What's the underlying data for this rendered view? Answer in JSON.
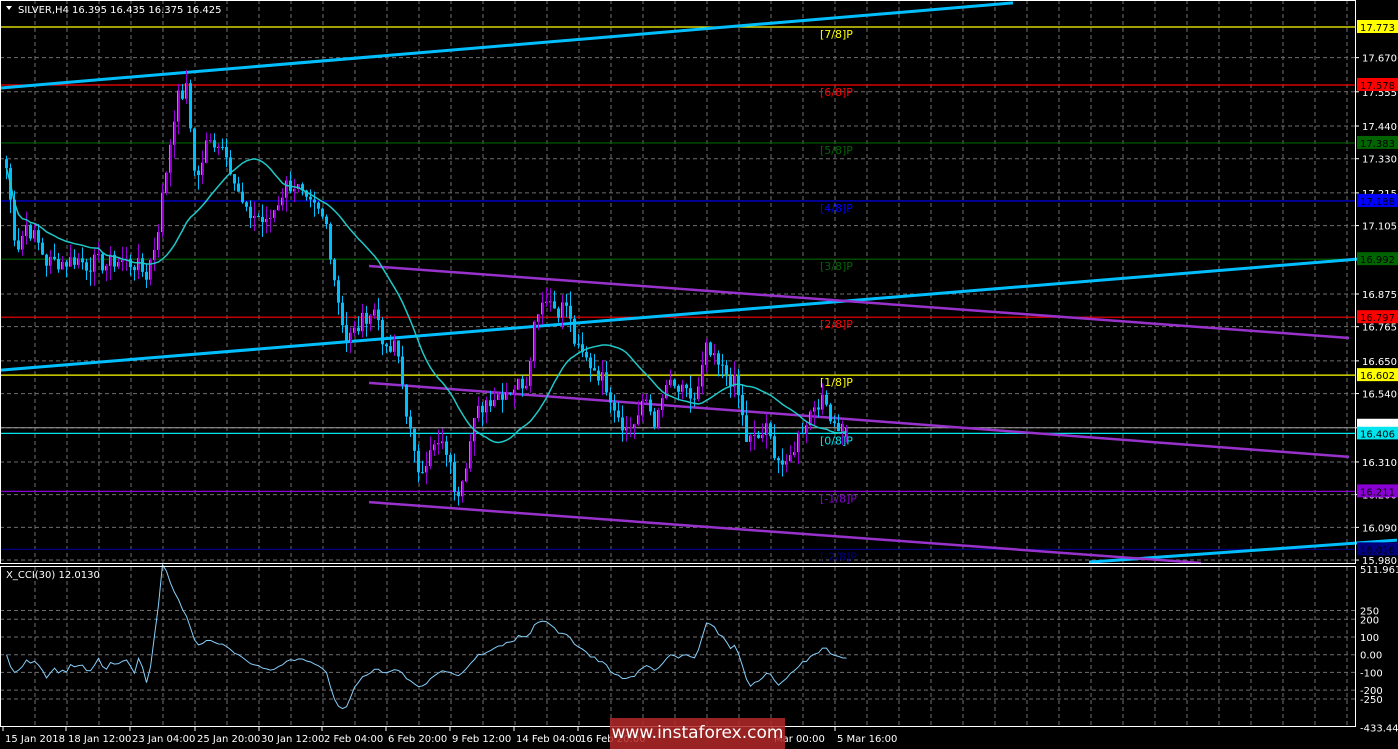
{
  "header": {
    "symbol": "SILVER,H4",
    "ohlc": "16.395 16.435 16.375 16.425"
  },
  "watermark": "www.instaforex.com",
  "chart_data": [
    {
      "type": "candlestick",
      "title": "SILVER,H4",
      "timeframe": "H4",
      "last_bar": {
        "open": 16.395,
        "high": 16.435,
        "low": 16.375,
        "close": 16.425
      },
      "ylim": [
        15.98,
        17.773
      ],
      "y_ticks": [
        "17.670",
        "17.555",
        "17.440",
        "17.330",
        "17.215",
        "17.105",
        "16.875",
        "16.765",
        "16.650",
        "16.540",
        "16.425",
        "16.310",
        "16.200",
        "16.090",
        "15.980"
      ],
      "x_ticks": [
        "15 Jan 2018",
        "18 Jan 12:00",
        "23 Jan 04:00",
        "25 Jan 20:00",
        "30 Jan 12:00",
        "2 Feb 04:00",
        "6 Feb 20:00",
        "9 Feb 12:00",
        "14 Feb 04:00",
        "16 Feb 20:00",
        "Mar 00:00",
        "5 Mar 16:00"
      ],
      "grid": true,
      "colors": {
        "bull": "#9400d3",
        "bull_edge": "#00ff00",
        "bear": "#00bfff",
        "ma": "#20c8c8",
        "background": "#000000",
        "grid": "#808080"
      },
      "close_path": [
        17.299,
        17.023,
        17.107,
        17.057,
        16.983,
        16.983,
        16.983,
        16.996,
        16.973,
        16.983,
        16.973,
        16.989,
        16.983,
        16.973,
        16.939,
        17.057,
        17.292,
        17.527,
        17.561,
        17.242,
        17.376,
        17.393,
        17.359,
        17.225,
        17.141,
        17.141,
        17.107,
        17.174,
        17.242,
        17.242,
        17.174,
        17.157,
        17.107,
        16.888,
        16.72,
        16.754,
        16.804,
        16.821,
        16.67,
        16.703,
        16.485,
        16.283,
        16.317,
        16.367,
        16.35,
        16.199,
        16.317,
        16.468,
        16.518,
        16.535,
        16.552,
        16.569,
        16.586,
        16.821,
        16.872,
        16.821,
        16.838,
        16.687,
        16.653,
        16.619,
        16.569,
        16.485,
        16.417,
        16.451,
        16.518,
        16.434,
        16.569,
        16.552,
        16.535,
        16.518,
        16.687,
        16.636,
        16.602,
        16.569,
        16.384,
        16.384,
        16.417,
        16.333,
        16.283,
        16.384,
        16.451,
        16.518,
        16.502,
        16.434,
        16.425
      ],
      "murrey_levels": [
        {
          "label": "[7/8]P",
          "price": 17.773,
          "value": "17.773",
          "color": "#ffff00"
        },
        {
          "label": "[6/8]P",
          "price": 17.578,
          "value": "17.578",
          "color": "#ff0000"
        },
        {
          "label": "[5/8]P",
          "price": 17.383,
          "value": "17.383",
          "color": "#006400"
        },
        {
          "label": "[4/8]P",
          "price": 17.188,
          "value": "17.188",
          "color": "#0000ff"
        },
        {
          "label": "[3/8]P",
          "price": 16.992,
          "value": "16.992",
          "color": "#006400"
        },
        {
          "label": "[2/8]P",
          "price": 16.797,
          "value": "16.797",
          "color": "#ff0000"
        },
        {
          "label": "[1/8]P",
          "price": 16.602,
          "value": "16.602",
          "color": "#ffff00"
        },
        {
          "label": "[0/8]P",
          "price": 16.406,
          "value": "16.406",
          "color": "#00e5ee"
        },
        {
          "label": "[-1/8]P",
          "price": 16.211,
          "value": "16.211",
          "color": "#8a00d4"
        },
        {
          "label": "[-2/8]P",
          "price": 16.016,
          "value": "16.016",
          "color": "#000080"
        }
      ],
      "current_price": {
        "value": "16.425",
        "price": 16.425
      },
      "trend_lines": [
        {
          "color": "#00bfff",
          "from_bar": -1,
          "from_price": 17.568,
          "to_bar": 252,
          "to_price": 17.854
        },
        {
          "color": "#00bfff",
          "from_bar": -1,
          "from_price": 16.619,
          "to_bar": 348,
          "to_price": 17.003
        },
        {
          "color": "#00bfff",
          "from_bar": 271,
          "from_price": 15.973,
          "to_bar": 348,
          "to_price": 16.047
        },
        {
          "color": "#9932cc",
          "from_bar": 91,
          "from_price": 16.969,
          "to_bar": 336,
          "to_price": 16.727
        },
        {
          "color": "#9932cc",
          "from_bar": 91,
          "from_price": 16.576,
          "to_bar": 336,
          "to_price": 16.327
        },
        {
          "color": "#9932cc",
          "from_bar": 91,
          "from_price": 16.175,
          "to_bar": 299,
          "to_price": 15.97
        }
      ]
    },
    {
      "type": "line",
      "title": "X_CCI(30) 12.0130",
      "ylim": [
        -433.442,
        511.9618
      ],
      "y_ticks": [
        "511.9618",
        "250",
        "200",
        "100",
        "0.00",
        "-100",
        "-200",
        "-250",
        "-433.442"
      ],
      "levels": [
        250,
        200,
        100,
        0,
        -100,
        -200,
        -250
      ],
      "colors": {
        "line": "#87cefa"
      }
    }
  ]
}
